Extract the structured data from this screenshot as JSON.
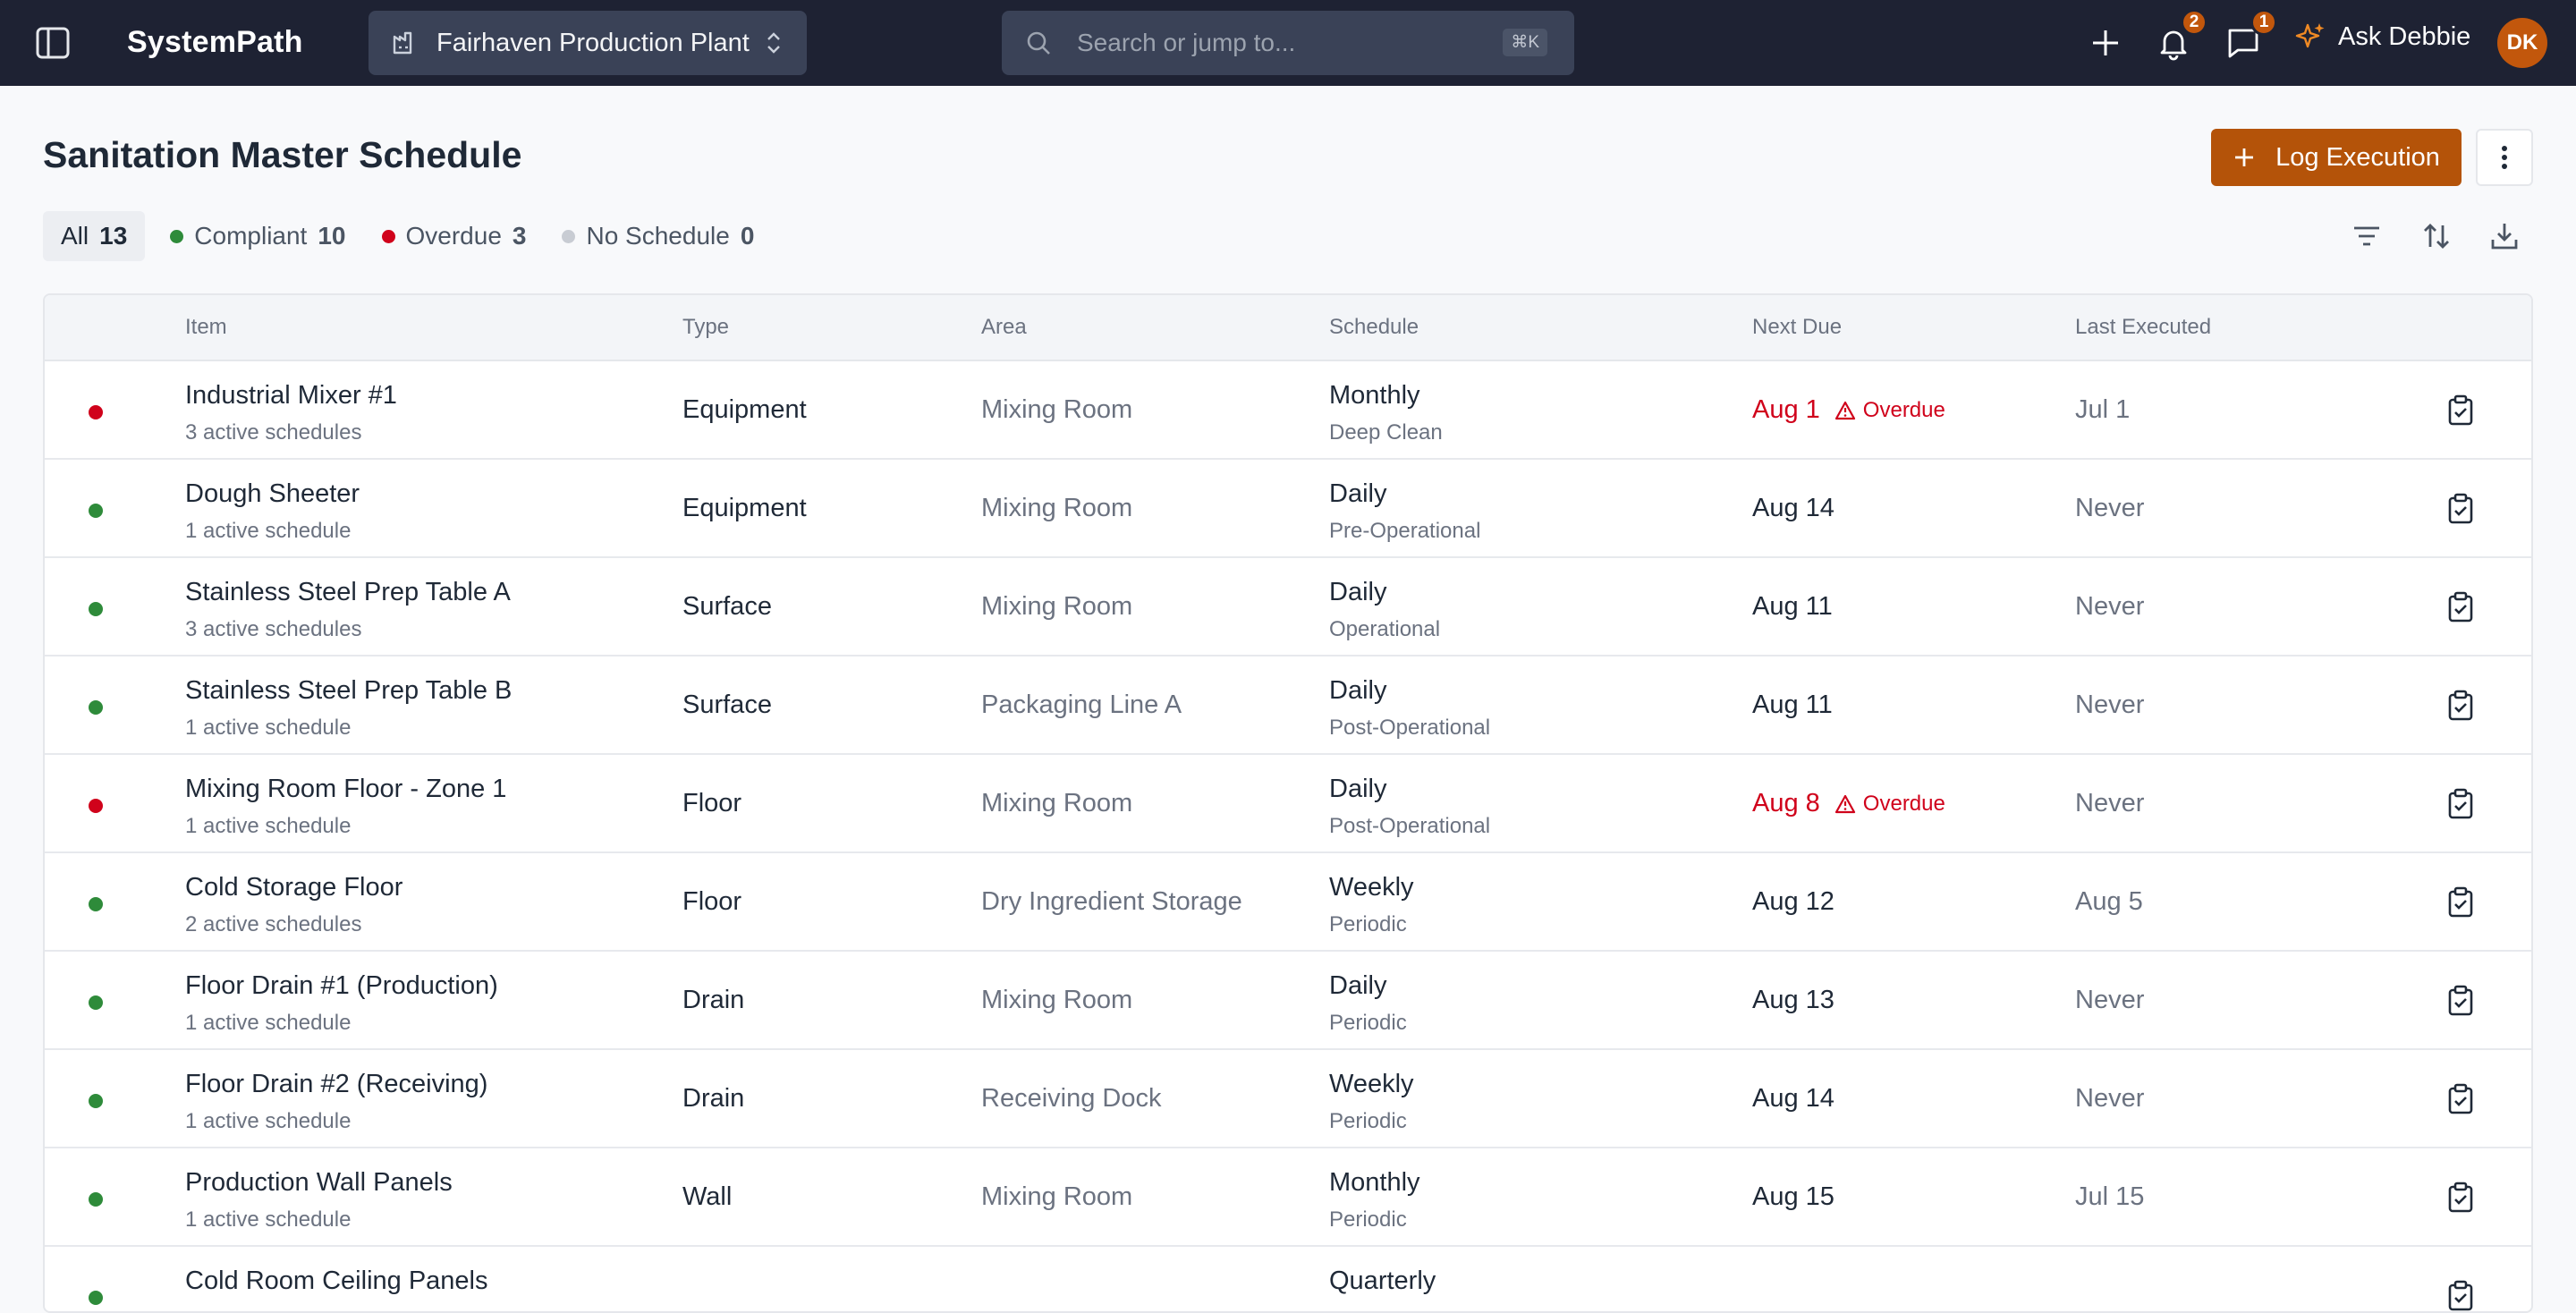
{
  "app": {
    "brand": "SystemPath"
  },
  "plant_select": {
    "value": "Fairhaven Production Plant"
  },
  "search": {
    "placeholder": "Search or jump to...",
    "shortcut": "⌘K"
  },
  "notifications": {
    "bell_count": "2",
    "chat_count": "1"
  },
  "assistant": {
    "label": "Ask Debbie"
  },
  "user": {
    "initials": "DK"
  },
  "page": {
    "title": "Sanitation Master Schedule",
    "log_button": "Log Execution"
  },
  "tabs": [
    {
      "label": "All",
      "count": "13"
    },
    {
      "label": "Compliant",
      "count": "10",
      "color": "#2e8b3a"
    },
    {
      "label": "Overdue",
      "count": "3",
      "color": "#d0021b"
    },
    {
      "label": "No Schedule",
      "count": "0",
      "color": "#c8ccd3"
    }
  ],
  "columns": [
    "Item",
    "Type",
    "Area",
    "Schedule",
    "Next Due",
    "Last Executed"
  ],
  "colors": {
    "compliant": "#2e8b3a",
    "overdue": "#d0021b",
    "accent": "#b45309",
    "topbar": "#1e2233"
  },
  "rows": [
    {
      "status": "overdue",
      "name": "Industrial Mixer #1",
      "sub": "3 active schedules",
      "type": "Equipment",
      "area": "Mixing Room",
      "schedule": "Monthly",
      "schedule_sub": "Deep Clean",
      "due": "Aug 1",
      "overdue_label": "Overdue",
      "last": "Jul 1"
    },
    {
      "status": "compliant",
      "name": "Dough Sheeter",
      "sub": "1 active schedule",
      "type": "Equipment",
      "area": "Mixing Room",
      "schedule": "Daily",
      "schedule_sub": "Pre-Operational",
      "due": "Aug 14",
      "overdue_label": "",
      "last": "Never"
    },
    {
      "status": "compliant",
      "name": "Stainless Steel Prep Table A",
      "sub": "3 active schedules",
      "type": "Surface",
      "area": "Mixing Room",
      "schedule": "Daily",
      "schedule_sub": "Operational",
      "due": "Aug 11",
      "overdue_label": "",
      "last": "Never"
    },
    {
      "status": "compliant",
      "name": "Stainless Steel Prep Table B",
      "sub": "1 active schedule",
      "type": "Surface",
      "area": "Packaging Line A",
      "schedule": "Daily",
      "schedule_sub": "Post-Operational",
      "due": "Aug 11",
      "overdue_label": "",
      "last": "Never"
    },
    {
      "status": "overdue",
      "name": "Mixing Room Floor - Zone 1",
      "sub": "1 active schedule",
      "type": "Floor",
      "area": "Mixing Room",
      "schedule": "Daily",
      "schedule_sub": "Post-Operational",
      "due": "Aug 8",
      "overdue_label": "Overdue",
      "last": "Never"
    },
    {
      "status": "compliant",
      "name": "Cold Storage Floor",
      "sub": "2 active schedules",
      "type": "Floor",
      "area": "Dry Ingredient Storage",
      "schedule": "Weekly",
      "schedule_sub": "Periodic",
      "due": "Aug 12",
      "overdue_label": "",
      "last": "Aug 5"
    },
    {
      "status": "compliant",
      "name": "Floor Drain #1 (Production)",
      "sub": "1 active schedule",
      "type": "Drain",
      "area": "Mixing Room",
      "schedule": "Daily",
      "schedule_sub": "Periodic",
      "due": "Aug 13",
      "overdue_label": "",
      "last": "Never"
    },
    {
      "status": "compliant",
      "name": "Floor Drain #2 (Receiving)",
      "sub": "1 active schedule",
      "type": "Drain",
      "area": "Receiving Dock",
      "schedule": "Weekly",
      "schedule_sub": "Periodic",
      "due": "Aug 14",
      "overdue_label": "",
      "last": "Never"
    },
    {
      "status": "compliant",
      "name": "Production Wall Panels",
      "sub": "1 active schedule",
      "type": "Wall",
      "area": "Mixing Room",
      "schedule": "Monthly",
      "schedule_sub": "Periodic",
      "due": "Aug 15",
      "overdue_label": "",
      "last": "Jul 15"
    },
    {
      "status": "compliant",
      "name": "Cold Room Ceiling Panels",
      "sub": "",
      "type": "",
      "area": "",
      "schedule": "Quarterly",
      "schedule_sub": "",
      "due": "",
      "overdue_label": "",
      "last": ""
    }
  ]
}
